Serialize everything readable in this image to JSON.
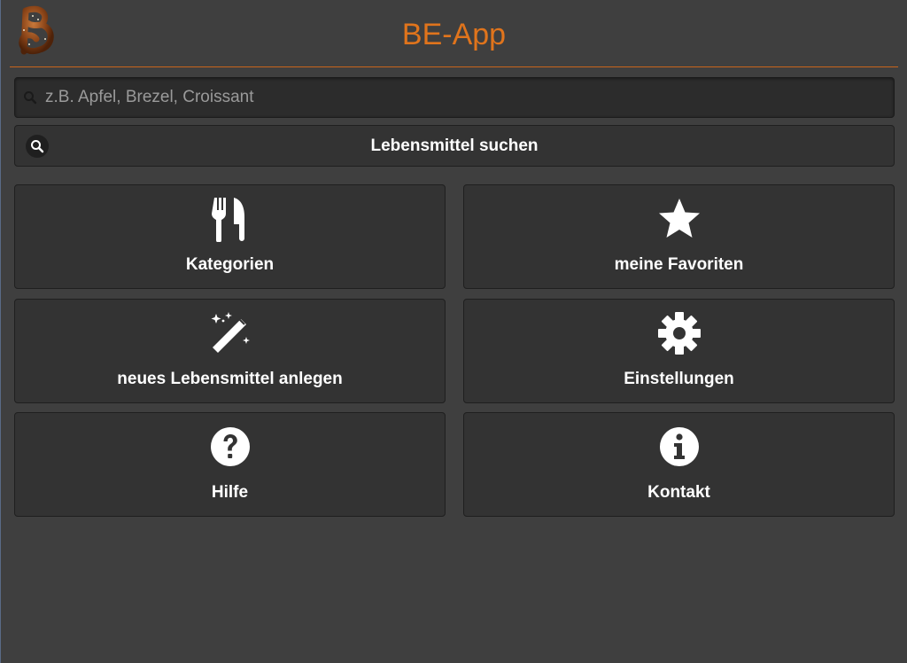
{
  "header": {
    "title": "BE-App",
    "logo_icon": "pretzel-b-logo",
    "title_color": "#e0741c",
    "divider_color": "#c8651b"
  },
  "search": {
    "placeholder": "z.B. Apfel, Brezel, Croissant",
    "value": "",
    "icon": "search-icon"
  },
  "search_button": {
    "label": "Lebensmittel suchen",
    "icon": "search-icon"
  },
  "tiles": [
    {
      "label": "Kategorien",
      "icon": "fork-knife-icon"
    },
    {
      "label": "meine Favoriten",
      "icon": "star-icon"
    },
    {
      "label": "neues Lebensmittel anlegen",
      "icon": "magic-wand-icon"
    },
    {
      "label": "Einstellungen",
      "icon": "gear-icon"
    },
    {
      "label": "Hilfe",
      "icon": "question-circle-icon"
    },
    {
      "label": "Kontakt",
      "icon": "info-circle-icon"
    }
  ],
  "colors": {
    "background": "#3f3f3f",
    "tile_background": "#333333",
    "text": "#ffffff"
  }
}
